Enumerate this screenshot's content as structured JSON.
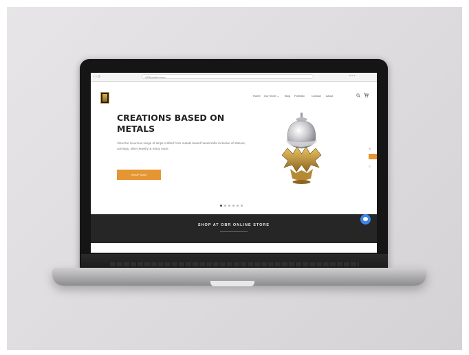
{
  "browser": {
    "controls": "‹ › ⟳",
    "url": "ORMetalArt.com",
    "extensions": "• • •"
  },
  "nav": {
    "items": [
      {
        "label": "Home"
      },
      {
        "label": "Our Store ⌄"
      },
      {
        "label": "Blog"
      },
      {
        "label": "Portfolio"
      },
      {
        "label": "Contact"
      },
      {
        "label": "About"
      }
    ],
    "search_icon": "search-icon",
    "cart_icon": "cart-icon"
  },
  "hero": {
    "title_line1": "CREATIONS BASED ON",
    "title_line2": "METALS",
    "description": "View the luxurious range of strips crafted from metals based handicrafts inclusive of statues, carvings, silver jewelry & many more.",
    "button_label": "SHOP NOW"
  },
  "carousel": {
    "slide_count": 6,
    "active_index": 0
  },
  "banner": {
    "title": "SHOP AT OBR ONLINE STORE"
  },
  "colors": {
    "accent": "#e59633",
    "banner_bg": "#262626",
    "chat": "#3f86e6"
  }
}
